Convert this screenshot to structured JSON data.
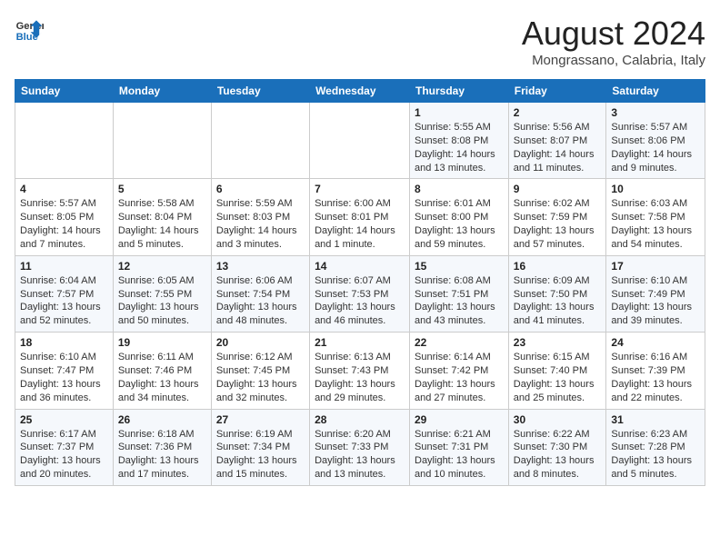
{
  "header": {
    "logo_line1": "General",
    "logo_line2": "Blue",
    "month_year": "August 2024",
    "location": "Mongrassano, Calabria, Italy"
  },
  "weekdays": [
    "Sunday",
    "Monday",
    "Tuesday",
    "Wednesday",
    "Thursday",
    "Friday",
    "Saturday"
  ],
  "weeks": [
    [
      {
        "day": "",
        "sunrise": "",
        "sunset": "",
        "daylight": ""
      },
      {
        "day": "",
        "sunrise": "",
        "sunset": "",
        "daylight": ""
      },
      {
        "day": "",
        "sunrise": "",
        "sunset": "",
        "daylight": ""
      },
      {
        "day": "",
        "sunrise": "",
        "sunset": "",
        "daylight": ""
      },
      {
        "day": "1",
        "sunrise": "Sunrise: 5:55 AM",
        "sunset": "Sunset: 8:08 PM",
        "daylight": "Daylight: 14 hours and 13 minutes."
      },
      {
        "day": "2",
        "sunrise": "Sunrise: 5:56 AM",
        "sunset": "Sunset: 8:07 PM",
        "daylight": "Daylight: 14 hours and 11 minutes."
      },
      {
        "day": "3",
        "sunrise": "Sunrise: 5:57 AM",
        "sunset": "Sunset: 8:06 PM",
        "daylight": "Daylight: 14 hours and 9 minutes."
      }
    ],
    [
      {
        "day": "4",
        "sunrise": "Sunrise: 5:57 AM",
        "sunset": "Sunset: 8:05 PM",
        "daylight": "Daylight: 14 hours and 7 minutes."
      },
      {
        "day": "5",
        "sunrise": "Sunrise: 5:58 AM",
        "sunset": "Sunset: 8:04 PM",
        "daylight": "Daylight: 14 hours and 5 minutes."
      },
      {
        "day": "6",
        "sunrise": "Sunrise: 5:59 AM",
        "sunset": "Sunset: 8:03 PM",
        "daylight": "Daylight: 14 hours and 3 minutes."
      },
      {
        "day": "7",
        "sunrise": "Sunrise: 6:00 AM",
        "sunset": "Sunset: 8:01 PM",
        "daylight": "Daylight: 14 hours and 1 minute."
      },
      {
        "day": "8",
        "sunrise": "Sunrise: 6:01 AM",
        "sunset": "Sunset: 8:00 PM",
        "daylight": "Daylight: 13 hours and 59 minutes."
      },
      {
        "day": "9",
        "sunrise": "Sunrise: 6:02 AM",
        "sunset": "Sunset: 7:59 PM",
        "daylight": "Daylight: 13 hours and 57 minutes."
      },
      {
        "day": "10",
        "sunrise": "Sunrise: 6:03 AM",
        "sunset": "Sunset: 7:58 PM",
        "daylight": "Daylight: 13 hours and 54 minutes."
      }
    ],
    [
      {
        "day": "11",
        "sunrise": "Sunrise: 6:04 AM",
        "sunset": "Sunset: 7:57 PM",
        "daylight": "Daylight: 13 hours and 52 minutes."
      },
      {
        "day": "12",
        "sunrise": "Sunrise: 6:05 AM",
        "sunset": "Sunset: 7:55 PM",
        "daylight": "Daylight: 13 hours and 50 minutes."
      },
      {
        "day": "13",
        "sunrise": "Sunrise: 6:06 AM",
        "sunset": "Sunset: 7:54 PM",
        "daylight": "Daylight: 13 hours and 48 minutes."
      },
      {
        "day": "14",
        "sunrise": "Sunrise: 6:07 AM",
        "sunset": "Sunset: 7:53 PM",
        "daylight": "Daylight: 13 hours and 46 minutes."
      },
      {
        "day": "15",
        "sunrise": "Sunrise: 6:08 AM",
        "sunset": "Sunset: 7:51 PM",
        "daylight": "Daylight: 13 hours and 43 minutes."
      },
      {
        "day": "16",
        "sunrise": "Sunrise: 6:09 AM",
        "sunset": "Sunset: 7:50 PM",
        "daylight": "Daylight: 13 hours and 41 minutes."
      },
      {
        "day": "17",
        "sunrise": "Sunrise: 6:10 AM",
        "sunset": "Sunset: 7:49 PM",
        "daylight": "Daylight: 13 hours and 39 minutes."
      }
    ],
    [
      {
        "day": "18",
        "sunrise": "Sunrise: 6:10 AM",
        "sunset": "Sunset: 7:47 PM",
        "daylight": "Daylight: 13 hours and 36 minutes."
      },
      {
        "day": "19",
        "sunrise": "Sunrise: 6:11 AM",
        "sunset": "Sunset: 7:46 PM",
        "daylight": "Daylight: 13 hours and 34 minutes."
      },
      {
        "day": "20",
        "sunrise": "Sunrise: 6:12 AM",
        "sunset": "Sunset: 7:45 PM",
        "daylight": "Daylight: 13 hours and 32 minutes."
      },
      {
        "day": "21",
        "sunrise": "Sunrise: 6:13 AM",
        "sunset": "Sunset: 7:43 PM",
        "daylight": "Daylight: 13 hours and 29 minutes."
      },
      {
        "day": "22",
        "sunrise": "Sunrise: 6:14 AM",
        "sunset": "Sunset: 7:42 PM",
        "daylight": "Daylight: 13 hours and 27 minutes."
      },
      {
        "day": "23",
        "sunrise": "Sunrise: 6:15 AM",
        "sunset": "Sunset: 7:40 PM",
        "daylight": "Daylight: 13 hours and 25 minutes."
      },
      {
        "day": "24",
        "sunrise": "Sunrise: 6:16 AM",
        "sunset": "Sunset: 7:39 PM",
        "daylight": "Daylight: 13 hours and 22 minutes."
      }
    ],
    [
      {
        "day": "25",
        "sunrise": "Sunrise: 6:17 AM",
        "sunset": "Sunset: 7:37 PM",
        "daylight": "Daylight: 13 hours and 20 minutes."
      },
      {
        "day": "26",
        "sunrise": "Sunrise: 6:18 AM",
        "sunset": "Sunset: 7:36 PM",
        "daylight": "Daylight: 13 hours and 17 minutes."
      },
      {
        "day": "27",
        "sunrise": "Sunrise: 6:19 AM",
        "sunset": "Sunset: 7:34 PM",
        "daylight": "Daylight: 13 hours and 15 minutes."
      },
      {
        "day": "28",
        "sunrise": "Sunrise: 6:20 AM",
        "sunset": "Sunset: 7:33 PM",
        "daylight": "Daylight: 13 hours and 13 minutes."
      },
      {
        "day": "29",
        "sunrise": "Sunrise: 6:21 AM",
        "sunset": "Sunset: 7:31 PM",
        "daylight": "Daylight: 13 hours and 10 minutes."
      },
      {
        "day": "30",
        "sunrise": "Sunrise: 6:22 AM",
        "sunset": "Sunset: 7:30 PM",
        "daylight": "Daylight: 13 hours and 8 minutes."
      },
      {
        "day": "31",
        "sunrise": "Sunrise: 6:23 AM",
        "sunset": "Sunset: 7:28 PM",
        "daylight": "Daylight: 13 hours and 5 minutes."
      }
    ]
  ]
}
